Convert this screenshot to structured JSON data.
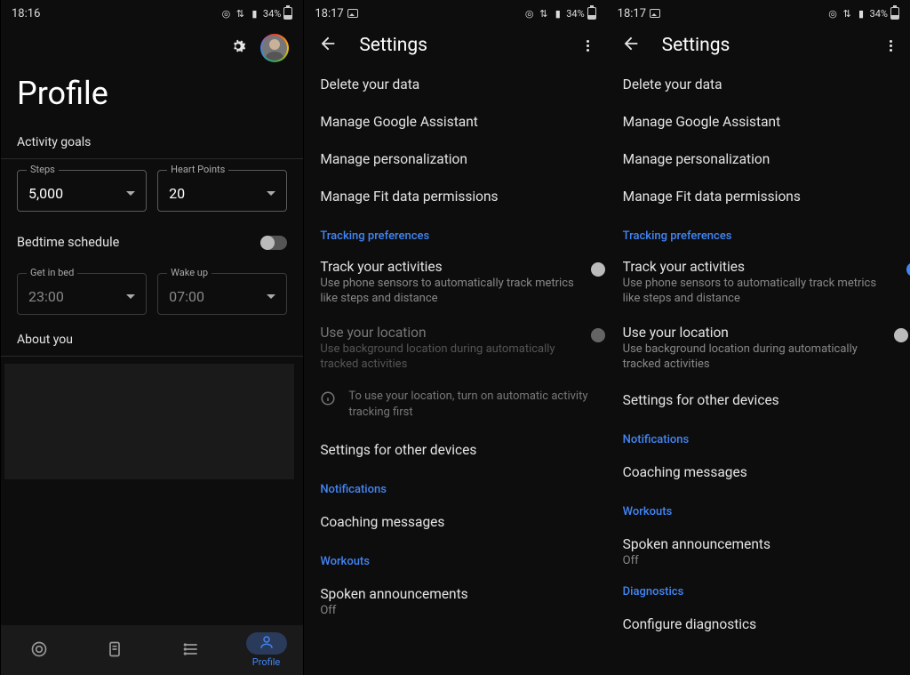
{
  "screen1": {
    "status": {
      "time": "18:16",
      "battery_pct": "34%"
    },
    "title": "Profile",
    "activity_goals_label": "Activity goals",
    "steps": {
      "legend": "Steps",
      "value": "5,000"
    },
    "heart": {
      "legend": "Heart Points",
      "value": "20"
    },
    "bedtime_label": "Bedtime schedule",
    "get_in_bed": {
      "legend": "Get in bed",
      "value": "23:00"
    },
    "wake_up": {
      "legend": "Wake up",
      "value": "07:00"
    },
    "about_you": "About you",
    "nav_profile": "Profile"
  },
  "screen2": {
    "status": {
      "time": "18:17",
      "battery_pct": "34%"
    },
    "title": "Settings",
    "items": {
      "delete": "Delete your data",
      "assistant": "Manage Google Assistant",
      "personalization": "Manage personalization",
      "permissions": "Manage Fit data permissions"
    },
    "tracking_header": "Tracking preferences",
    "track_title": "Track your activities",
    "track_desc": "Use phone sensors to automatically track metrics like steps and distance",
    "loc_title": "Use your location",
    "loc_desc": "Use background location during automatically tracked activities",
    "info": "To use your location, turn on automatic activity tracking first",
    "other_devices": "Settings for other devices",
    "notif_header": "Notifications",
    "coaching": "Coaching messages",
    "workouts_header": "Workouts",
    "spoken_title": "Spoken announcements",
    "spoken_val": "Off"
  },
  "screen3": {
    "status": {
      "time": "18:17",
      "battery_pct": "34%"
    },
    "title": "Settings",
    "items": {
      "delete": "Delete your data",
      "assistant": "Manage Google Assistant",
      "personalization": "Manage personalization",
      "permissions": "Manage Fit data permissions"
    },
    "tracking_header": "Tracking preferences",
    "track_title": "Track your activities",
    "track_desc": "Use phone sensors to automatically track metrics like steps and distance",
    "loc_title": "Use your location",
    "loc_desc": "Use background location during automatically tracked activities",
    "other_devices": "Settings for other devices",
    "notif_header": "Notifications",
    "coaching": "Coaching messages",
    "workouts_header": "Workouts",
    "spoken_title": "Spoken announcements",
    "spoken_val": "Off",
    "diag_header": "Diagnostics",
    "diag_item": "Configure diagnostics"
  }
}
